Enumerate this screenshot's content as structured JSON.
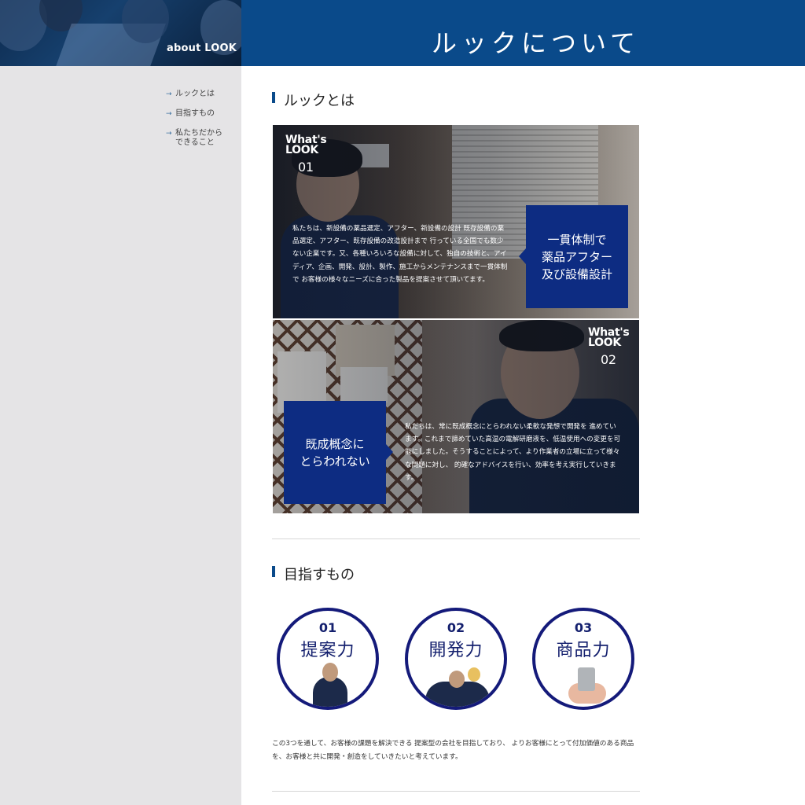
{
  "header": {
    "section_label": "about LOOK",
    "page_title": "ルックについて"
  },
  "sidebar": {
    "items": [
      {
        "label": "ルックとは"
      },
      {
        "label": "目指すもの"
      },
      {
        "label": "私たちだから\nできること"
      }
    ]
  },
  "sections": {
    "about": {
      "heading": "ルックとは",
      "panels": [
        {
          "whats_line1": "What's",
          "whats_line2": "LOOK",
          "number": "01",
          "text": "私たちは、新設備の薬品選定、アフター、新設備の設計 既存設備の薬品選定、アフター、既存設備の改造設計まで 行っている全国でも数少ない企業です。又、各種いろいろな設備に対して、独自の技術と、アイディア、企画、開発、設計、製作、施工からメンテナンスまで一貫体制で お客様の様々なニーズに合った製品を提案させて頂いてます。",
          "callout_lines": [
            "一貫体制で",
            "薬品アフター",
            "及び設備設計"
          ]
        },
        {
          "whats_line1": "What's",
          "whats_line2": "LOOK",
          "number": "02",
          "text": "私たちは、常に既成概念にとらわれない柔軟な発想で開発を 進めています。これまで諦めていた高温の電解研磨液を、低温使用への変更を可能にしました。そうすることによって、より作業者の立場に立って様々な問題に対し、 的確なアドバイスを行い、効率を考え実行していきます。",
          "callout_lines": [
            "既成概念に",
            "とらわれない"
          ]
        }
      ]
    },
    "goals": {
      "heading": "目指すもの",
      "items": [
        {
          "number": "01",
          "label": "提案力"
        },
        {
          "number": "02",
          "label": "開発力"
        },
        {
          "number": "03",
          "label": "商品力"
        }
      ],
      "description": "この3つを通して、お客様の課題を解決できる 提案型の会社を目指しており、 よりお客様にとって付加価値のある商品を、お客様と共に開発・創造をしていきたいと考えています。"
    }
  },
  "colors": {
    "brand_blue": "#0a4a8a",
    "callout_navy": "#0d2c82",
    "circle_border": "#141a7a",
    "sidebar_bg": "#e5e4e6"
  },
  "icons": {
    "sidebar_bullet": "arrow-right-icon"
  }
}
